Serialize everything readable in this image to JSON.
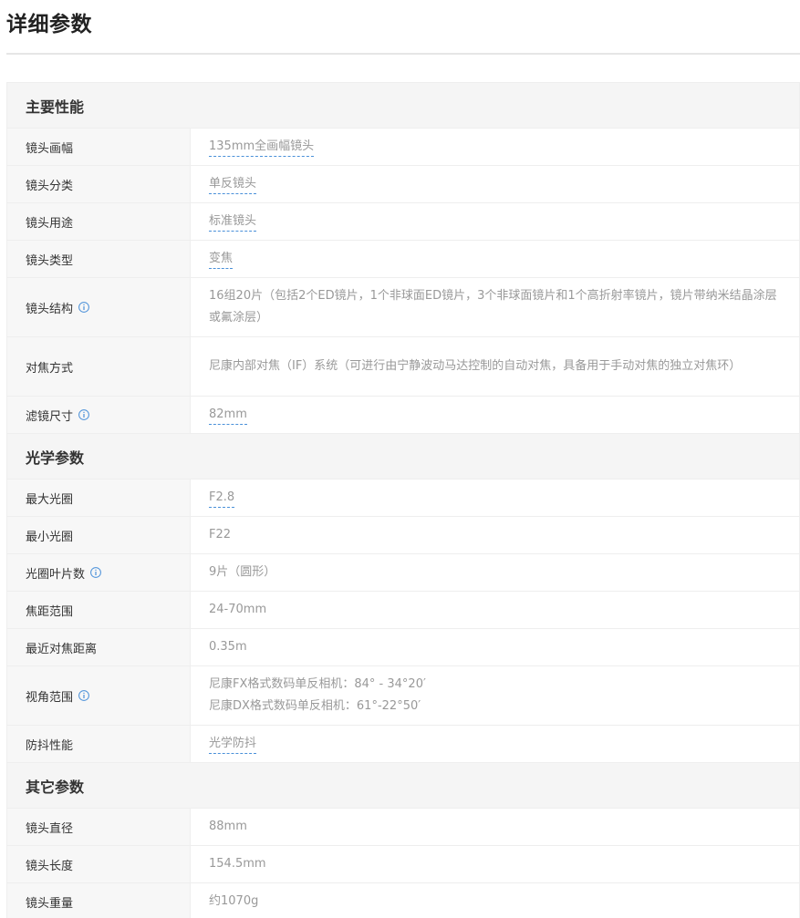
{
  "page": {
    "title": "详细参数"
  },
  "colors": {
    "link_underline": "#4a90d9",
    "info_icon": "#4a90d9",
    "label_text": "#333333",
    "value_text": "#999999",
    "group_bg": "#f5f5f5"
  },
  "icons": {
    "info": "info-circle-icon"
  },
  "groups": [
    {
      "title": "主要性能",
      "rows": [
        {
          "label": "镜头画幅",
          "values": [
            "135mm全画幅镜头"
          ],
          "linked": true,
          "info": false,
          "tall": false
        },
        {
          "label": "镜头分类",
          "values": [
            "单反镜头"
          ],
          "linked": true,
          "info": false,
          "tall": false
        },
        {
          "label": "镜头用途",
          "values": [
            "标准镜头"
          ],
          "linked": true,
          "info": false,
          "tall": false
        },
        {
          "label": "镜头类型",
          "values": [
            "变焦"
          ],
          "linked": true,
          "info": false,
          "tall": false
        },
        {
          "label": "镜头结构",
          "values": [
            "16组20片（包括2个ED镜片，1个非球面ED镜片，3个非球面镜片和1个高折射率镜片，镜片带纳米结晶涂层或氟涂层）"
          ],
          "linked": false,
          "info": true,
          "tall": true
        },
        {
          "label": "对焦方式",
          "values": [
            "尼康内部对焦（IF）系统（可进行由宁静波动马达控制的自动对焦，具备用于手动对焦的独立对焦环）"
          ],
          "linked": false,
          "info": false,
          "tall": true
        },
        {
          "label": "滤镜尺寸",
          "values": [
            "82mm"
          ],
          "linked": true,
          "info": true,
          "tall": false
        }
      ]
    },
    {
      "title": "光学参数",
      "rows": [
        {
          "label": "最大光圈",
          "values": [
            "F2.8"
          ],
          "linked": true,
          "info": false,
          "tall": false
        },
        {
          "label": "最小光圈",
          "values": [
            "F22"
          ],
          "linked": false,
          "info": false,
          "tall": false
        },
        {
          "label": "光圈叶片数",
          "values": [
            "9片（圆形）"
          ],
          "linked": false,
          "info": true,
          "tall": false
        },
        {
          "label": "焦距范围",
          "values": [
            "24-70mm"
          ],
          "linked": false,
          "info": false,
          "tall": false
        },
        {
          "label": "最近对焦距离",
          "values": [
            "0.35m"
          ],
          "linked": false,
          "info": false,
          "tall": false
        },
        {
          "label": "视角范围",
          "values": [
            "尼康FX格式数码单反相机：84° - 34°20′",
            "尼康DX格式数码单反相机：61°-22°50′"
          ],
          "linked": false,
          "info": true,
          "tall": true
        },
        {
          "label": "防抖性能",
          "values": [
            "光学防抖"
          ],
          "linked": true,
          "info": false,
          "tall": false
        }
      ]
    },
    {
      "title": "其它参数",
      "rows": [
        {
          "label": "镜头直径",
          "values": [
            "88mm"
          ],
          "linked": false,
          "info": false,
          "tall": false
        },
        {
          "label": "镜头长度",
          "values": [
            "154.5mm"
          ],
          "linked": false,
          "info": false,
          "tall": false
        },
        {
          "label": "镜头重量",
          "values": [
            "约1070g"
          ],
          "linked": false,
          "info": false,
          "tall": false
        }
      ]
    }
  ]
}
